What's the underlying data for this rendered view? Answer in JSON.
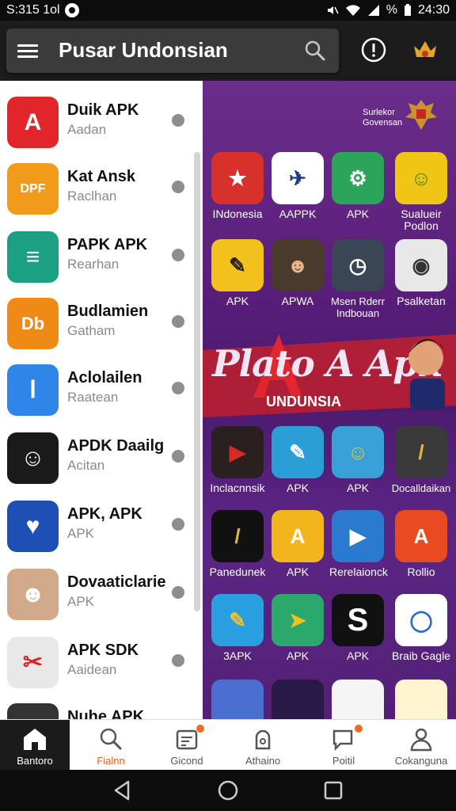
{
  "status_bar": {
    "time_left": "S:315 1ol",
    "battery_text": "%",
    "time_right": "24:30"
  },
  "header": {
    "title": "Pusar Undonsian"
  },
  "sidebar": {
    "items": [
      {
        "name": "Duik APK",
        "sub": "Aadan",
        "color": "#e2252b",
        "glyph": "A"
      },
      {
        "name": "Kat Ansk",
        "sub": "Raclhan",
        "color": "#f29a1a",
        "glyph": "DPF"
      },
      {
        "name": "PAPK APK",
        "sub": "Rearhan",
        "color": "#1ba084",
        "glyph": "≡"
      },
      {
        "name": "Budlamien",
        "sub": "Gatham",
        "color": "#f08a16",
        "glyph": "Db"
      },
      {
        "name": "Aclolailen",
        "sub": "Raatean",
        "color": "#2f86e8",
        "glyph": "Ⅰ"
      },
      {
        "name": "APDK Daailg",
        "sub": "Acitan",
        "color": "#1a1a1a",
        "glyph": "☺"
      },
      {
        "name": "APK, APK",
        "sub": "APK",
        "color": "#1e4fb5",
        "glyph": "♥"
      },
      {
        "name": "Dovaaticlarie",
        "sub": "APK",
        "color": "#cfa98a",
        "glyph": "☻"
      },
      {
        "name": "APK SDK",
        "sub": "Aaidean",
        "color": "#e8e8e8",
        "glyph": "✂"
      },
      {
        "name": "Nuhe APK",
        "sub": "",
        "color": "#333333",
        "glyph": "☺"
      }
    ]
  },
  "main": {
    "corner_text": [
      "Surlekor",
      "Govensan"
    ],
    "apps_row1": [
      {
        "label": "INdonesia",
        "color": "#d8302a",
        "glyph": "★"
      },
      {
        "label": "AAPPK",
        "color": "#ffffff",
        "glyph": "✈"
      },
      {
        "label": "APK",
        "color": "#2aa55a",
        "glyph": "⚙"
      },
      {
        "label": "Sualueir Podlon",
        "color": "#f1c516",
        "glyph": "☺"
      }
    ],
    "apps_row2": [
      {
        "label": "APK",
        "color": "#f3c11e",
        "glyph": "✎"
      },
      {
        "label": "APWA",
        "color": "#4a3a2c",
        "glyph": "☻"
      },
      {
        "label": "Msen Rderr Indbouan",
        "color": "#3a4655",
        "glyph": "◷"
      },
      {
        "label": "Psalketan",
        "color": "#e8e8e8",
        "glyph": "◉"
      }
    ],
    "banner_title": "Plato A Apk",
    "banner_sub": "UNDUNSIA",
    "apps_row3": [
      {
        "label": "Inclacnnsik",
        "color": "#2a2020",
        "glyph": "▶"
      },
      {
        "label": "APK",
        "color": "#2c9ed6",
        "glyph": "✎"
      },
      {
        "label": "APK",
        "color": "#3aa0d8",
        "glyph": "☺"
      },
      {
        "label": "Docalldaikan",
        "color": "#3a3a3a",
        "glyph": "/"
      }
    ],
    "apps_row4": [
      {
        "label": "Panedunek",
        "color": "#111111",
        "glyph": "/"
      },
      {
        "label": "APK",
        "color": "#f2b51c",
        "glyph": "A"
      },
      {
        "label": "Rerelaionck",
        "color": "#2a7ad0",
        "glyph": "▶"
      },
      {
        "label": "Rollio",
        "color": "#e84a22",
        "glyph": "A"
      }
    ],
    "apps_row5": [
      {
        "label": "3APK",
        "color": "#2a9fe0",
        "glyph": "✎"
      },
      {
        "label": "APK",
        "color": "#2ba86c",
        "glyph": "➤"
      },
      {
        "label": "APK",
        "color": "#111111",
        "glyph": "S"
      },
      {
        "label": "Braib Gagle",
        "color": "#ffffff",
        "glyph": "◯"
      }
    ],
    "apps_row6": [
      {
        "color": "#4a6fd0"
      },
      {
        "color": "#2a1a4a"
      },
      {
        "color": "#f5f5f5"
      },
      {
        "color": "#fff3d0"
      }
    ]
  },
  "bottom_nav": {
    "items": [
      {
        "label": "Bantoro",
        "icon": "home-icon"
      },
      {
        "label": "Fialnn",
        "icon": "search-icon"
      },
      {
        "label": "Gicond",
        "icon": "calendar-icon"
      },
      {
        "label": "Athaino",
        "icon": "lock-icon"
      },
      {
        "label": "Poitil",
        "icon": "chat-icon"
      },
      {
        "label": "Cokanguna",
        "icon": "person-icon"
      }
    ]
  },
  "colors": {
    "accent": "#ef5a0e",
    "purple": "#5b1f7c",
    "dark": "#1c1c1c"
  }
}
